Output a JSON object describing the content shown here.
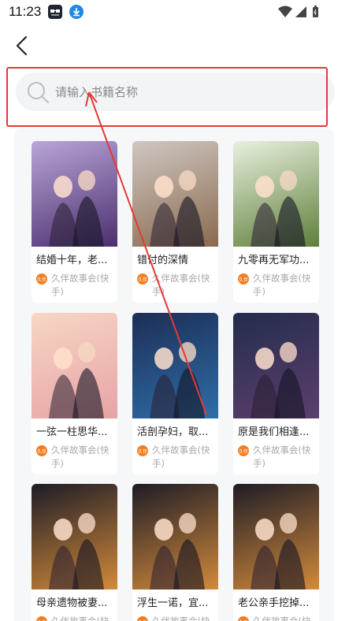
{
  "status_bar": {
    "time": "11:23",
    "icons": [
      "app-notification-icon",
      "download-icon",
      "wifi-icon",
      "signal-icon",
      "battery-icon"
    ]
  },
  "header": {
    "back_icon": "chevron-left-icon"
  },
  "search": {
    "placeholder": "请输入书籍名称",
    "value": "",
    "icon": "search-icon",
    "highlight_color": "#e53935"
  },
  "books": [
    {
      "title": "结婚十年，老...",
      "publisher": "久伴故事会(快手)",
      "cover_colors": [
        "#b9a5d8",
        "#4b2f6e"
      ]
    },
    {
      "title": "错付的深情",
      "publisher": "久伴故事会(快手)",
      "cover_colors": [
        "#cfc7c2",
        "#8a6a4e"
      ]
    },
    {
      "title": "九零再无军功...",
      "publisher": "久伴故事会(快手)",
      "cover_colors": [
        "#e8f0df",
        "#5f7f3a"
      ]
    },
    {
      "title": "一弦一柱思华...",
      "publisher": "久伴故事会(快手)",
      "cover_colors": [
        "#f6d7c5",
        "#e8a3a5"
      ]
    },
    {
      "title": "活剖孕妇，取...",
      "publisher": "久伴故事会(快手)",
      "cover_colors": [
        "#1c2e55",
        "#2f6ea8"
      ]
    },
    {
      "title": "原是我们相逢...",
      "publisher": "久伴故事会(快手)",
      "cover_colors": [
        "#232c4d",
        "#5d3f6e"
      ]
    },
    {
      "title": "母亲遗物被妻...",
      "publisher": "久伴故事会(快手)",
      "cover_colors": [
        "#1e1c26",
        "#d38a3a"
      ]
    },
    {
      "title": "浮生一诺，宜...",
      "publisher": "久伴故事会(快手)",
      "cover_colors": [
        "#1e1c26",
        "#d38a3a"
      ]
    },
    {
      "title": "老公亲手挖掉...",
      "publisher": "久伴故事会(快手)",
      "cover_colors": [
        "#1e1c26",
        "#d38a3a"
      ]
    }
  ],
  "publisher_badge_text": "久伴",
  "accent_color": "#f57c1f"
}
